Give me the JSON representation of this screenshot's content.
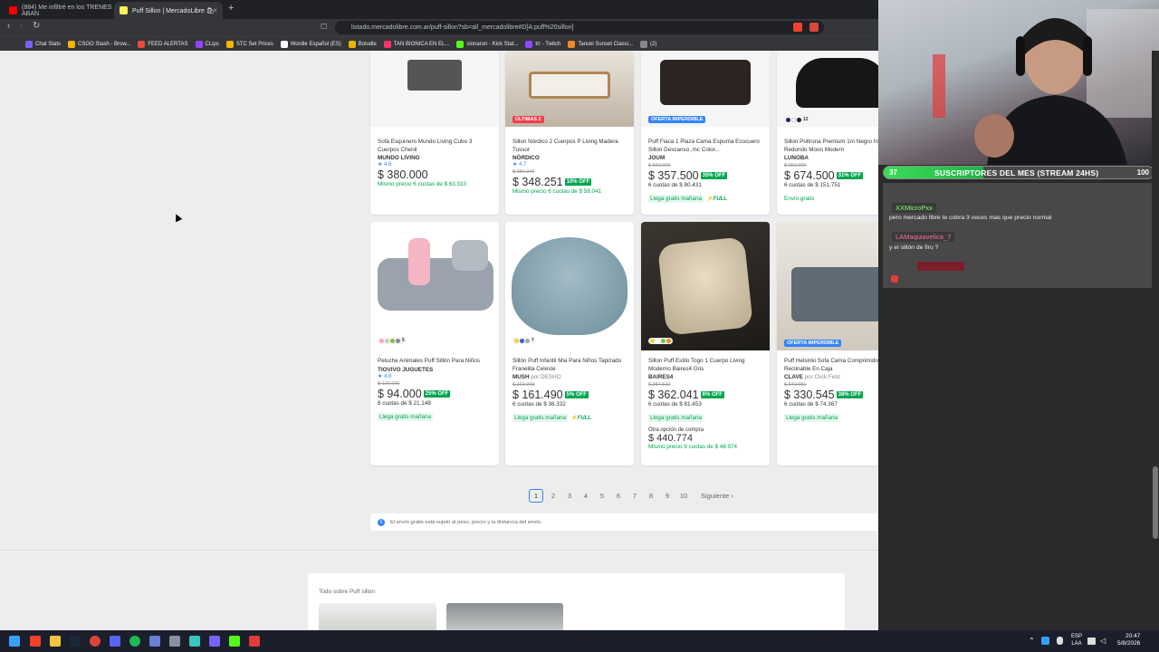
{
  "browser": {
    "tabs": [
      {
        "label": "(884) Me infiltré en los TRENES ABAN",
        "active": false
      },
      {
        "label": "Puff Sillon | MercadoLibre 🛍",
        "active": true
      }
    ],
    "new_tab": "+",
    "close_glyph": "×",
    "url": "listado.mercadolibre.com.ar/puff-sillon?sb=all_mercadolibre#D[A:puff%20sillon]",
    "bookmarks": [
      "Chat Stats",
      "CSGO Stash - Brow...",
      "FEED ALERTAS",
      "CLips",
      "STC Set Prices",
      "Wordle Español (ES)",
      "Boludle",
      "TAN BIONICA EN EL...",
      "sionaron - Kick Stat...",
      "trr - Twitch",
      "Tanuki Sunset Classi...",
      "(2)"
    ]
  },
  "products_top": [
    {
      "title": "Sofá Esquinero Mundo Living Cubo 3 Cuerpos Chenil",
      "brand": "MUNDO LIVING",
      "rating": "★ 4.6",
      "price": "$ 380.000",
      "installments": "Mismo precio 6 cuotas de $ 63.333",
      "installments_green": true
    },
    {
      "title": "Sillon Nórdico 2 Cuerpos P Living Madera Tussor",
      "brand": "NÓRDICO",
      "rating": "★ 4.7",
      "old_price": "$ 386.946",
      "price": "$ 348.251",
      "discount": "10% OFF",
      "installments": "Mismo precio 6 cuotas de $ 58.041",
      "installments_green": true,
      "tag": "ÚLTIMAS 2"
    },
    {
      "title": "Puff Fiaca 1 Plaza Cama Espuma Ecocuero Sillon Descanso ,mc Color...",
      "brand": "JOUM",
      "old_price": "$ 550.000",
      "price": "$ 357.500",
      "discount": "35% OFF",
      "installments": "6 cuotas de $ 80.431",
      "shipping": "Llega gratis mañana",
      "full": "⚡FULL",
      "tag": "OFERTA IMPERDIBLE"
    },
    {
      "title": "Sillon Poltrona Premium 1m Negro Individual Redondo Moon Modern",
      "brand": "LUNOBA",
      "old_price": "$ 950.000",
      "price": "$ 674.500",
      "discount": "31% OFF",
      "installments": "6 cuotas de $ 151.751",
      "shipping": "Envío gratis"
    }
  ],
  "products_bottom": [
    {
      "title": "Peluche Animales Puff Sillón Para Niños",
      "brand": "TIOVIVO JUGUETES",
      "rating": "★ 4.8",
      "old_price": "$ 126.000",
      "price": "$ 94.000",
      "discount": "25% OFF",
      "installments": "6 cuotas de $ 21.148",
      "shipping": "Llega gratis mañana",
      "color_count": "5"
    },
    {
      "title": "Sillón Puff Infantil Mia Para Niños Tapizado Franelita Celeste",
      "brand": "MUSH",
      "seller": "por DESHO",
      "old_price": "$ 169.990",
      "price": "$ 161.490",
      "discount": "5% OFF",
      "installments": "6 cuotas de $ 36.332",
      "shipping": "Llega gratis mañana",
      "full": "⚡FULL",
      "color_count": "7"
    },
    {
      "title": "Sillon Puff Estilo Togo 1 Cuerpo Living Moderno Baires4 Gris",
      "brand": "BAIRES4",
      "old_price": "$ 387.529",
      "price": "$ 362.041",
      "discount": "6% OFF",
      "installments": "6 cuotas de $ 81.453",
      "shipping": "Llega gratis mañana",
      "alt_label": "Otra opción de compra",
      "alt_price": "$ 440.774",
      "alt_inst": "Mismo precio 9 cuotas de $ 48.974"
    },
    {
      "title": "Puff Helsinki Sofa Cama Comprimido Reclinable En Caja",
      "brand": "CLAVE",
      "seller": "por Click Feliz",
      "old_price": "$ 540.981",
      "price": "$ 330.545",
      "discount": "38% OFF",
      "installments": "6 cuotas de $ 74.367",
      "shipping": "Llega gratis mañana",
      "tag": "OFERTA IMPERDIBLE"
    }
  ],
  "pagination": {
    "pages": [
      "1",
      "2",
      "3",
      "4",
      "5",
      "6",
      "7",
      "8",
      "9",
      "10"
    ],
    "current": "1",
    "next": "Siguiente ›"
  },
  "shipping_note": "El envío gratis está sujeto al peso, precio y la distancia del envío.",
  "related_title": "Todo sobre Puff sillon",
  "stream": {
    "sub_goal": {
      "current": "37",
      "title": "SUSCRIPTORES DEL MES (STREAM 24HS)",
      "total": "100",
      "progress": 0.37
    },
    "chat": [
      {
        "user": "XXMicroPxx",
        "message": "pero mercado libre te cobra 3 veces mas que precio normal"
      },
      {
        "user": "LAMaquiavelica_7",
        "message": "y el sillón de firu ?"
      }
    ]
  },
  "taskbar": {
    "lang": "ESP",
    "lang2": "LAA",
    "time": "20:47",
    "date": "5/8/2026"
  },
  "colors": {
    "ml_blue": "#3483fa",
    "ml_green": "#00a650",
    "sub_green": "#2fd14f"
  }
}
